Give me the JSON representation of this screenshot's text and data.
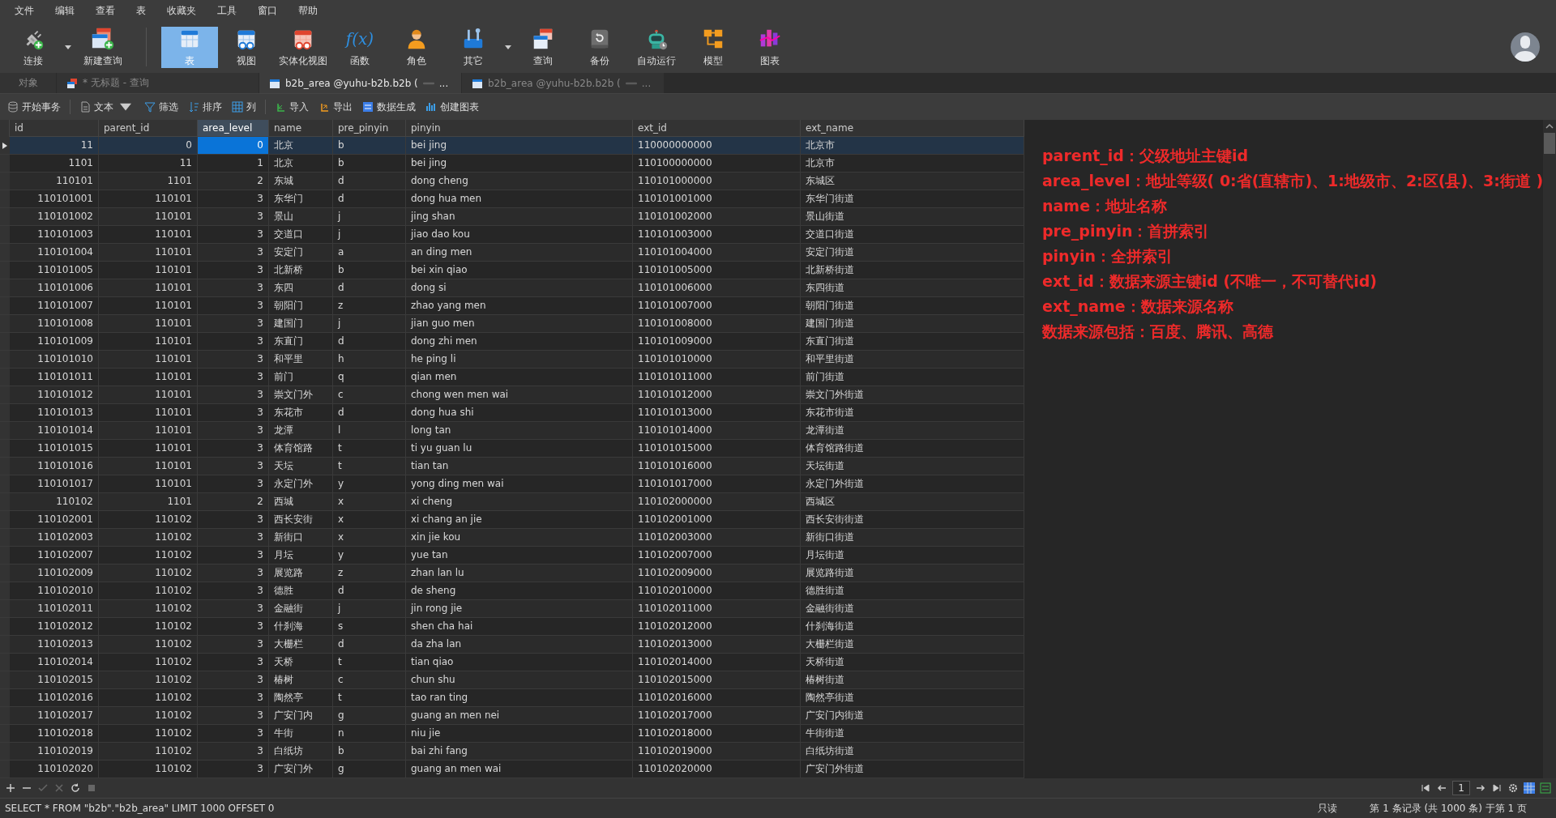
{
  "menu_bar": [
    "文件",
    "编辑",
    "查看",
    "表",
    "收藏夹",
    "工具",
    "窗口",
    "帮助"
  ],
  "toolbar": [
    {
      "label": "连接",
      "selected": false,
      "dropdown": true
    },
    {
      "label": "新建查询",
      "selected": false,
      "dropdown": false
    },
    {
      "label": "表",
      "selected": true,
      "dropdown": false
    },
    {
      "label": "视图",
      "selected": false,
      "dropdown": false
    },
    {
      "label": "实体化视图",
      "selected": false,
      "dropdown": false
    },
    {
      "label": "函数",
      "selected": false,
      "dropdown": false,
      "glyph": "f(x)"
    },
    {
      "label": "角色",
      "selected": false,
      "dropdown": false
    },
    {
      "label": "其它",
      "selected": false,
      "dropdown": true
    },
    {
      "label": "查询",
      "selected": false,
      "dropdown": false
    },
    {
      "label": "备份",
      "selected": false,
      "dropdown": false
    },
    {
      "label": "自动运行",
      "selected": false,
      "dropdown": false
    },
    {
      "label": "模型",
      "selected": false,
      "dropdown": false
    },
    {
      "label": "图表",
      "selected": false,
      "dropdown": false
    }
  ],
  "tabs": [
    {
      "label": "对象",
      "selected": false
    },
    {
      "label": "* 无标题 - 查询",
      "selected": false
    },
    {
      "label": "b2b_area @yuhu-b2b.b2b (",
      "suffix": "...",
      "selected": true
    },
    {
      "label": "b2b_area @yuhu-b2b.b2b (",
      "suffix": "...",
      "selected": false
    }
  ],
  "table_toolbar": [
    {
      "label": "开始事务",
      "dropdown": false
    },
    {
      "label": "文本",
      "dropdown": true
    },
    {
      "label": "筛选",
      "dropdown": false
    },
    {
      "label": "排序",
      "dropdown": false
    },
    {
      "label": "列",
      "dropdown": false
    },
    {
      "label": "导入",
      "dropdown": false
    },
    {
      "label": "导出",
      "dropdown": false
    },
    {
      "label": "数据生成",
      "dropdown": false
    },
    {
      "label": "创建图表",
      "dropdown": false
    }
  ],
  "table": {
    "columns": [
      {
        "name": "id",
        "numeric": true,
        "focused": false
      },
      {
        "name": "parent_id",
        "numeric": true,
        "focused": false
      },
      {
        "name": "area_level",
        "numeric": true,
        "focused": true
      },
      {
        "name": "name",
        "numeric": false,
        "focused": false
      },
      {
        "name": "pre_pinyin",
        "numeric": false,
        "focused": false
      },
      {
        "name": "pinyin",
        "numeric": false,
        "focused": false
      },
      {
        "name": "ext_id",
        "numeric": false,
        "focused": false
      },
      {
        "name": "ext_name",
        "numeric": false,
        "focused": false
      }
    ],
    "rows": [
      {
        "selected": true,
        "cells": [
          "11",
          "0",
          "0",
          "北京",
          "b",
          "bei jing",
          "110000000000",
          "北京市"
        ]
      },
      {
        "selected": false,
        "cells": [
          "1101",
          "11",
          "1",
          "北京",
          "b",
          "bei jing",
          "110100000000",
          "北京市"
        ]
      },
      {
        "selected": false,
        "cells": [
          "110101",
          "1101",
          "2",
          "东城",
          "d",
          "dong cheng",
          "110101000000",
          "东城区"
        ]
      },
      {
        "selected": false,
        "cells": [
          "110101001",
          "110101",
          "3",
          "东华门",
          "d",
          "dong hua men",
          "110101001000",
          "东华门街道"
        ]
      },
      {
        "selected": false,
        "cells": [
          "110101002",
          "110101",
          "3",
          "景山",
          "j",
          "jing shan",
          "110101002000",
          "景山街道"
        ]
      },
      {
        "selected": false,
        "cells": [
          "110101003",
          "110101",
          "3",
          "交道口",
          "j",
          "jiao dao kou",
          "110101003000",
          "交道口街道"
        ]
      },
      {
        "selected": false,
        "cells": [
          "110101004",
          "110101",
          "3",
          "安定门",
          "a",
          "an ding men",
          "110101004000",
          "安定门街道"
        ]
      },
      {
        "selected": false,
        "cells": [
          "110101005",
          "110101",
          "3",
          "北新桥",
          "b",
          "bei xin qiao",
          "110101005000",
          "北新桥街道"
        ]
      },
      {
        "selected": false,
        "cells": [
          "110101006",
          "110101",
          "3",
          "东四",
          "d",
          "dong si",
          "110101006000",
          "东四街道"
        ]
      },
      {
        "selected": false,
        "cells": [
          "110101007",
          "110101",
          "3",
          "朝阳门",
          "z",
          "zhao yang men",
          "110101007000",
          "朝阳门街道"
        ]
      },
      {
        "selected": false,
        "cells": [
          "110101008",
          "110101",
          "3",
          "建国门",
          "j",
          "jian guo men",
          "110101008000",
          "建国门街道"
        ]
      },
      {
        "selected": false,
        "cells": [
          "110101009",
          "110101",
          "3",
          "东直门",
          "d",
          "dong zhi men",
          "110101009000",
          "东直门街道"
        ]
      },
      {
        "selected": false,
        "cells": [
          "110101010",
          "110101",
          "3",
          "和平里",
          "h",
          "he ping li",
          "110101010000",
          "和平里街道"
        ]
      },
      {
        "selected": false,
        "cells": [
          "110101011",
          "110101",
          "3",
          "前门",
          "q",
          "qian men",
          "110101011000",
          "前门街道"
        ]
      },
      {
        "selected": false,
        "cells": [
          "110101012",
          "110101",
          "3",
          "崇文门外",
          "c",
          "chong wen men wai",
          "110101012000",
          "崇文门外街道"
        ]
      },
      {
        "selected": false,
        "cells": [
          "110101013",
          "110101",
          "3",
          "东花市",
          "d",
          "dong hua shi",
          "110101013000",
          "东花市街道"
        ]
      },
      {
        "selected": false,
        "cells": [
          "110101014",
          "110101",
          "3",
          "龙潭",
          "l",
          "long tan",
          "110101014000",
          "龙潭街道"
        ]
      },
      {
        "selected": false,
        "cells": [
          "110101015",
          "110101",
          "3",
          "体育馆路",
          "t",
          "ti yu guan lu",
          "110101015000",
          "体育馆路街道"
        ]
      },
      {
        "selected": false,
        "cells": [
          "110101016",
          "110101",
          "3",
          "天坛",
          "t",
          "tian tan",
          "110101016000",
          "天坛街道"
        ]
      },
      {
        "selected": false,
        "cells": [
          "110101017",
          "110101",
          "3",
          "永定门外",
          "y",
          "yong ding men wai",
          "110101017000",
          "永定门外街道"
        ]
      },
      {
        "selected": false,
        "cells": [
          "110102",
          "1101",
          "2",
          "西城",
          "x",
          "xi cheng",
          "110102000000",
          "西城区"
        ]
      },
      {
        "selected": false,
        "cells": [
          "110102001",
          "110102",
          "3",
          "西长安街",
          "x",
          "xi chang an jie",
          "110102001000",
          "西长安街街道"
        ]
      },
      {
        "selected": false,
        "cells": [
          "110102003",
          "110102",
          "3",
          "新街口",
          "x",
          "xin jie kou",
          "110102003000",
          "新街口街道"
        ]
      },
      {
        "selected": false,
        "cells": [
          "110102007",
          "110102",
          "3",
          "月坛",
          "y",
          "yue tan",
          "110102007000",
          "月坛街道"
        ]
      },
      {
        "selected": false,
        "cells": [
          "110102009",
          "110102",
          "3",
          "展览路",
          "z",
          "zhan lan lu",
          "110102009000",
          "展览路街道"
        ]
      },
      {
        "selected": false,
        "cells": [
          "110102010",
          "110102",
          "3",
          "德胜",
          "d",
          "de sheng",
          "110102010000",
          "德胜街道"
        ]
      },
      {
        "selected": false,
        "cells": [
          "110102011",
          "110102",
          "3",
          "金融街",
          "j",
          "jin rong jie",
          "110102011000",
          "金融街街道"
        ]
      },
      {
        "selected": false,
        "cells": [
          "110102012",
          "110102",
          "3",
          "什刹海",
          "s",
          "shen cha hai",
          "110102012000",
          "什刹海街道"
        ]
      },
      {
        "selected": false,
        "cells": [
          "110102013",
          "110102",
          "3",
          "大栅栏",
          "d",
          "da zha lan",
          "110102013000",
          "大栅栏街道"
        ]
      },
      {
        "selected": false,
        "cells": [
          "110102014",
          "110102",
          "3",
          "天桥",
          "t",
          "tian qiao",
          "110102014000",
          "天桥街道"
        ]
      },
      {
        "selected": false,
        "cells": [
          "110102015",
          "110102",
          "3",
          "椿树",
          "c",
          "chun shu",
          "110102015000",
          "椿树街道"
        ]
      },
      {
        "selected": false,
        "cells": [
          "110102016",
          "110102",
          "3",
          "陶然亭",
          "t",
          "tao ran ting",
          "110102016000",
          "陶然亭街道"
        ]
      },
      {
        "selected": false,
        "cells": [
          "110102017",
          "110102",
          "3",
          "广安门内",
          "g",
          "guang an men nei",
          "110102017000",
          "广安门内街道"
        ]
      },
      {
        "selected": false,
        "cells": [
          "110102018",
          "110102",
          "3",
          "牛街",
          "n",
          "niu jie",
          "110102018000",
          "牛街街道"
        ]
      },
      {
        "selected": false,
        "cells": [
          "110102019",
          "110102",
          "3",
          "白纸坊",
          "b",
          "bai zhi fang",
          "110102019000",
          "白纸坊街道"
        ]
      },
      {
        "selected": false,
        "cells": [
          "110102020",
          "110102",
          "3",
          "广安门外",
          "g",
          "guang an men wai",
          "110102020000",
          "广安门外街道"
        ]
      }
    ]
  },
  "annotations": [
    "parent_id：父级地址主键id",
    "area_level：地址等级( 0:省(直辖市)、1:地级市、2:区(县)、3:街道 )",
    "name：地址名称",
    "pre_pinyin：首拼索引",
    "pinyin：全拼索引",
    "ext_id：数据来源主键id (不唯一，不可替代id)",
    "ext_name：数据来源名称",
    "数据来源包括：百度、腾讯、高德"
  ],
  "pager": {
    "page": "1"
  },
  "status_bar": {
    "query": "SELECT * FROM \"b2b\".\"b2b_area\" LIMIT 1000 OFFSET 0",
    "mode": "只读",
    "record": "第 1 条记录 (共 1000 条) 于第 1 页"
  }
}
